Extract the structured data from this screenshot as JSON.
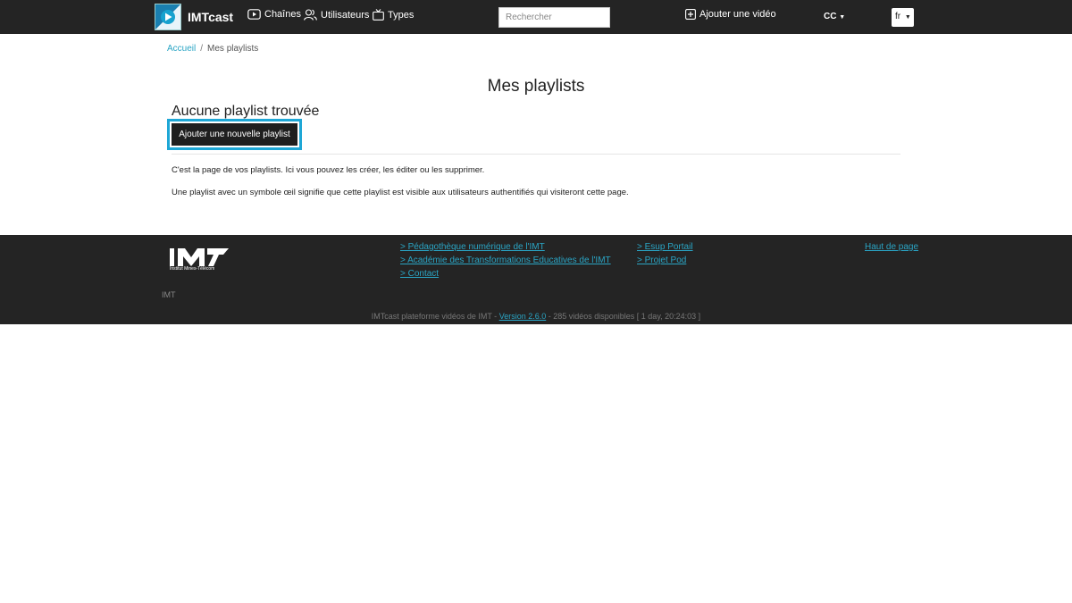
{
  "navbar": {
    "brand": "IMTcast",
    "links": [
      {
        "label": "Chaînes",
        "icon": "play-circle-icon"
      },
      {
        "label": "Utilisateurs",
        "icon": "users-icon"
      },
      {
        "label": "Types",
        "icon": "tv-icon"
      }
    ],
    "search_placeholder": "Rechercher",
    "add_video_label": "Ajouter une vidéo",
    "cc_label": "CC",
    "lang_label": "fr"
  },
  "breadcrumb": {
    "home": "Accueil",
    "current": "Mes playlists"
  },
  "main": {
    "title": "Mes playlists",
    "subtitle": "Aucune playlist trouvée",
    "add_button": "Ajouter une nouvelle playlist",
    "paragraphs": [
      "C'est la page de vos playlists. Ici vous pouvez les créer, les éditer ou les supprimer.",
      "Une playlist avec un symbole œil signifie que cette playlist est visible aux utilisateurs authentifiés qui visiteront cette page."
    ]
  },
  "footer": {
    "logo_caption": "Institut Mines-Télécom",
    "links_col1": [
      "> Pédagothèque numérique de l'IMT",
      "> Académie des Transformations Educatives de l'IMT",
      "> Contact"
    ],
    "links_col2": [
      "> Esup Portail",
      "> Projet Pod"
    ],
    "top_link": "Haut de page",
    "org": "IMT",
    "note_prefix": "IMTcast plateforme vidéos de IMT - ",
    "version": "Version 2.6.0",
    "note_suffix": " - 285 vidéos disponibles [ 1 day, 20:24:03 ]"
  },
  "colors": {
    "navbar_bg": "#242424",
    "accent": "#2aa5c5",
    "highlight_border": "#1ea7d6"
  }
}
